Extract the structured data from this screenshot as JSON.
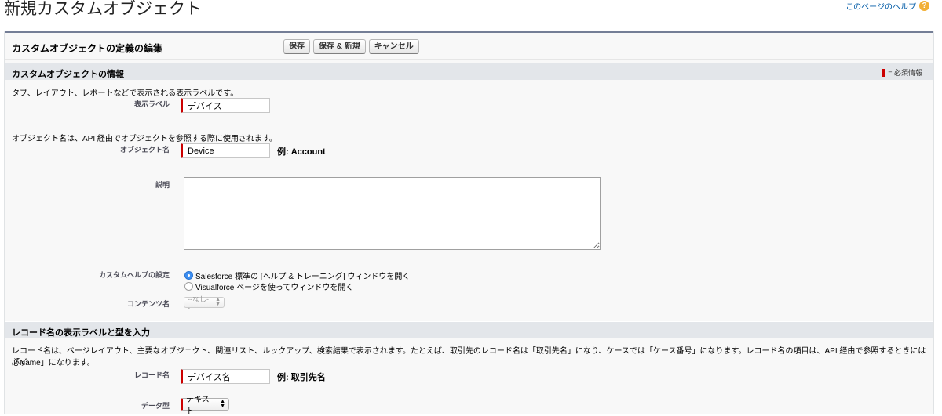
{
  "page": {
    "title": "新規カスタムオブジェクト",
    "help_link": "このページのヘルプ",
    "help_icon": "?"
  },
  "form": {
    "title": "カスタムオブジェクトの定義の編集",
    "buttons": {
      "save": "保存",
      "save_new": "保存 & 新規",
      "cancel": "キャンセル"
    }
  },
  "section_info": {
    "title": "カスタムオブジェクトの情報",
    "required_legend": "= 必須情報",
    "label_help": "タブ、レイアウト、レポートなどで表示される表示ラベルです。",
    "label_field": {
      "label": "表示ラベル",
      "value": "デバイス"
    },
    "object_help": "オブジェクト名は、API 経由でオブジェクトを参照する際に使用されます。",
    "object_field": {
      "label": "オブジェクト名",
      "value": "Device",
      "example": "例:  Account"
    },
    "description_label": "説明",
    "custom_help_label": "カスタムヘルプの設定",
    "custom_help_options": [
      {
        "label": "Salesforce 標準の [ヘルプ & トレーニング] ウィンドウを開く",
        "checked": true
      },
      {
        "label": "Visualforce ページを使ってウィンドウを開く",
        "checked": false
      }
    ],
    "content_name_label": "コンテンツ名",
    "content_name_value": "--なし--"
  },
  "section_record": {
    "title": "レコード名の表示ラベルと型を入力",
    "help_line1": "レコード名は、ページレイアウト、主要なオブジェクト、関連リスト、ルックアップ、検索結果で表示されます。たとえば、取引先のレコード名は「取引先名」になり、ケースでは「ケース番号」になります。レコード名の項目は、API 経由で参照するときには必ず",
    "help_line2": "「Name」になります。",
    "record_name_field": {
      "label": "レコード名",
      "value": "デバイス名",
      "example": "例:  取引先名"
    },
    "data_type_label": "データ型",
    "data_type_value": "テキスト"
  },
  "colors": {
    "accent_border": "#747e96",
    "required": "#cc0000",
    "section_bg": "#e3e6ea",
    "link": "#015ba7"
  }
}
